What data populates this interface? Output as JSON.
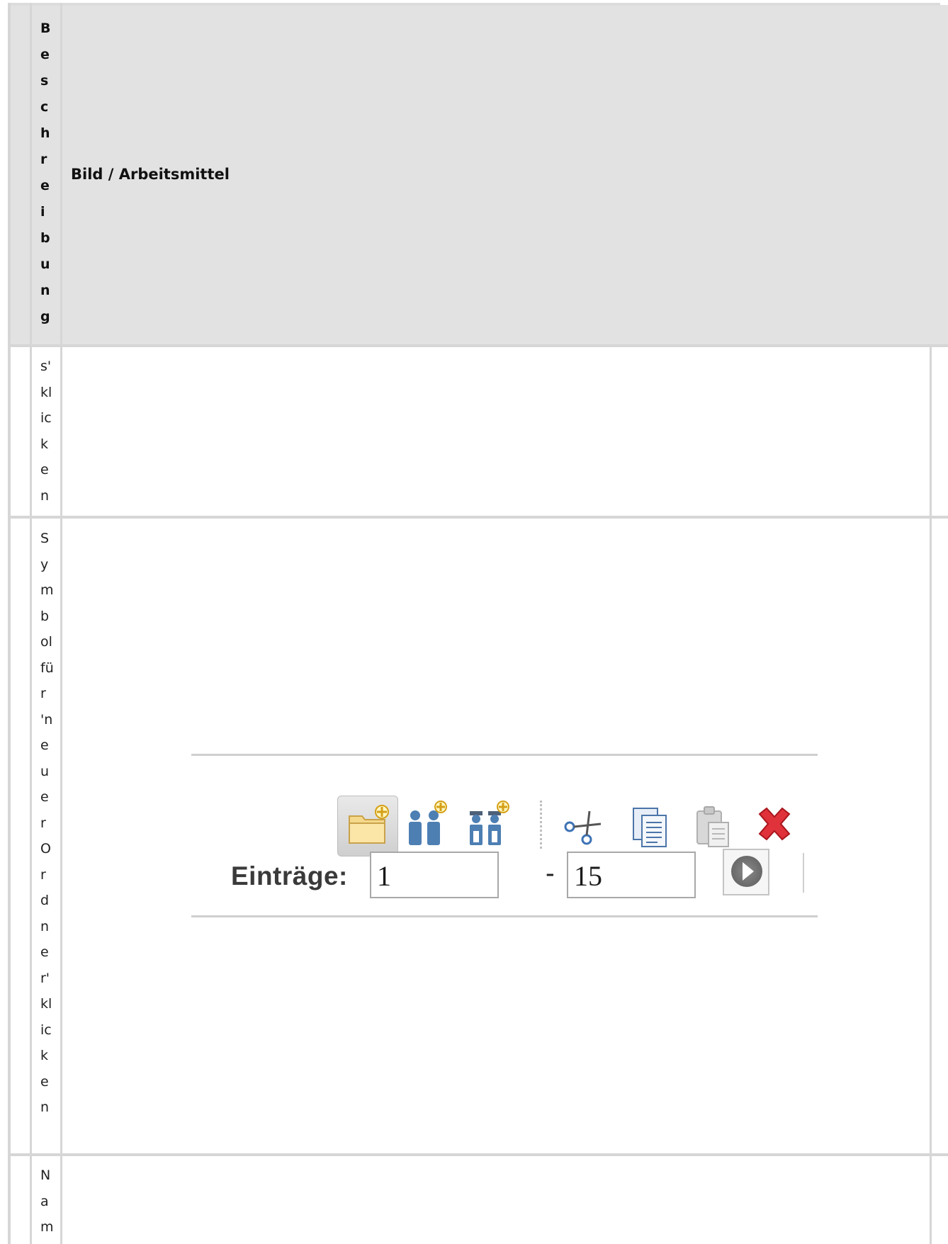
{
  "table": {
    "header": {
      "col1": "B\ne\ns\nc\nh\nr\ne\ni\nb\nu\nn\ng",
      "col2": "Bild / Arbeitsmittel"
    },
    "rows": [
      {
        "col1": "s'\nkl\nic\nk\ne\nn"
      },
      {
        "col1": "S\ny\nm\nb\nol\nfü\nr\n'n\ne\nu\ne\nr\nO\nr\nd\nn\ne\nr'\nkl\nic\nk\ne\nn"
      },
      {
        "col1": "N\na\nm"
      }
    ]
  },
  "toolbar": {
    "icons": [
      "new-folder-icon",
      "new-user-icon",
      "new-group-icon",
      "cut-icon",
      "copy-icon",
      "paste-icon",
      "delete-icon"
    ],
    "entries_label": "Einträge:",
    "range_from": "1",
    "range_separator": "-",
    "range_to": "15",
    "go_icon": "arrow-right-circle-icon"
  }
}
